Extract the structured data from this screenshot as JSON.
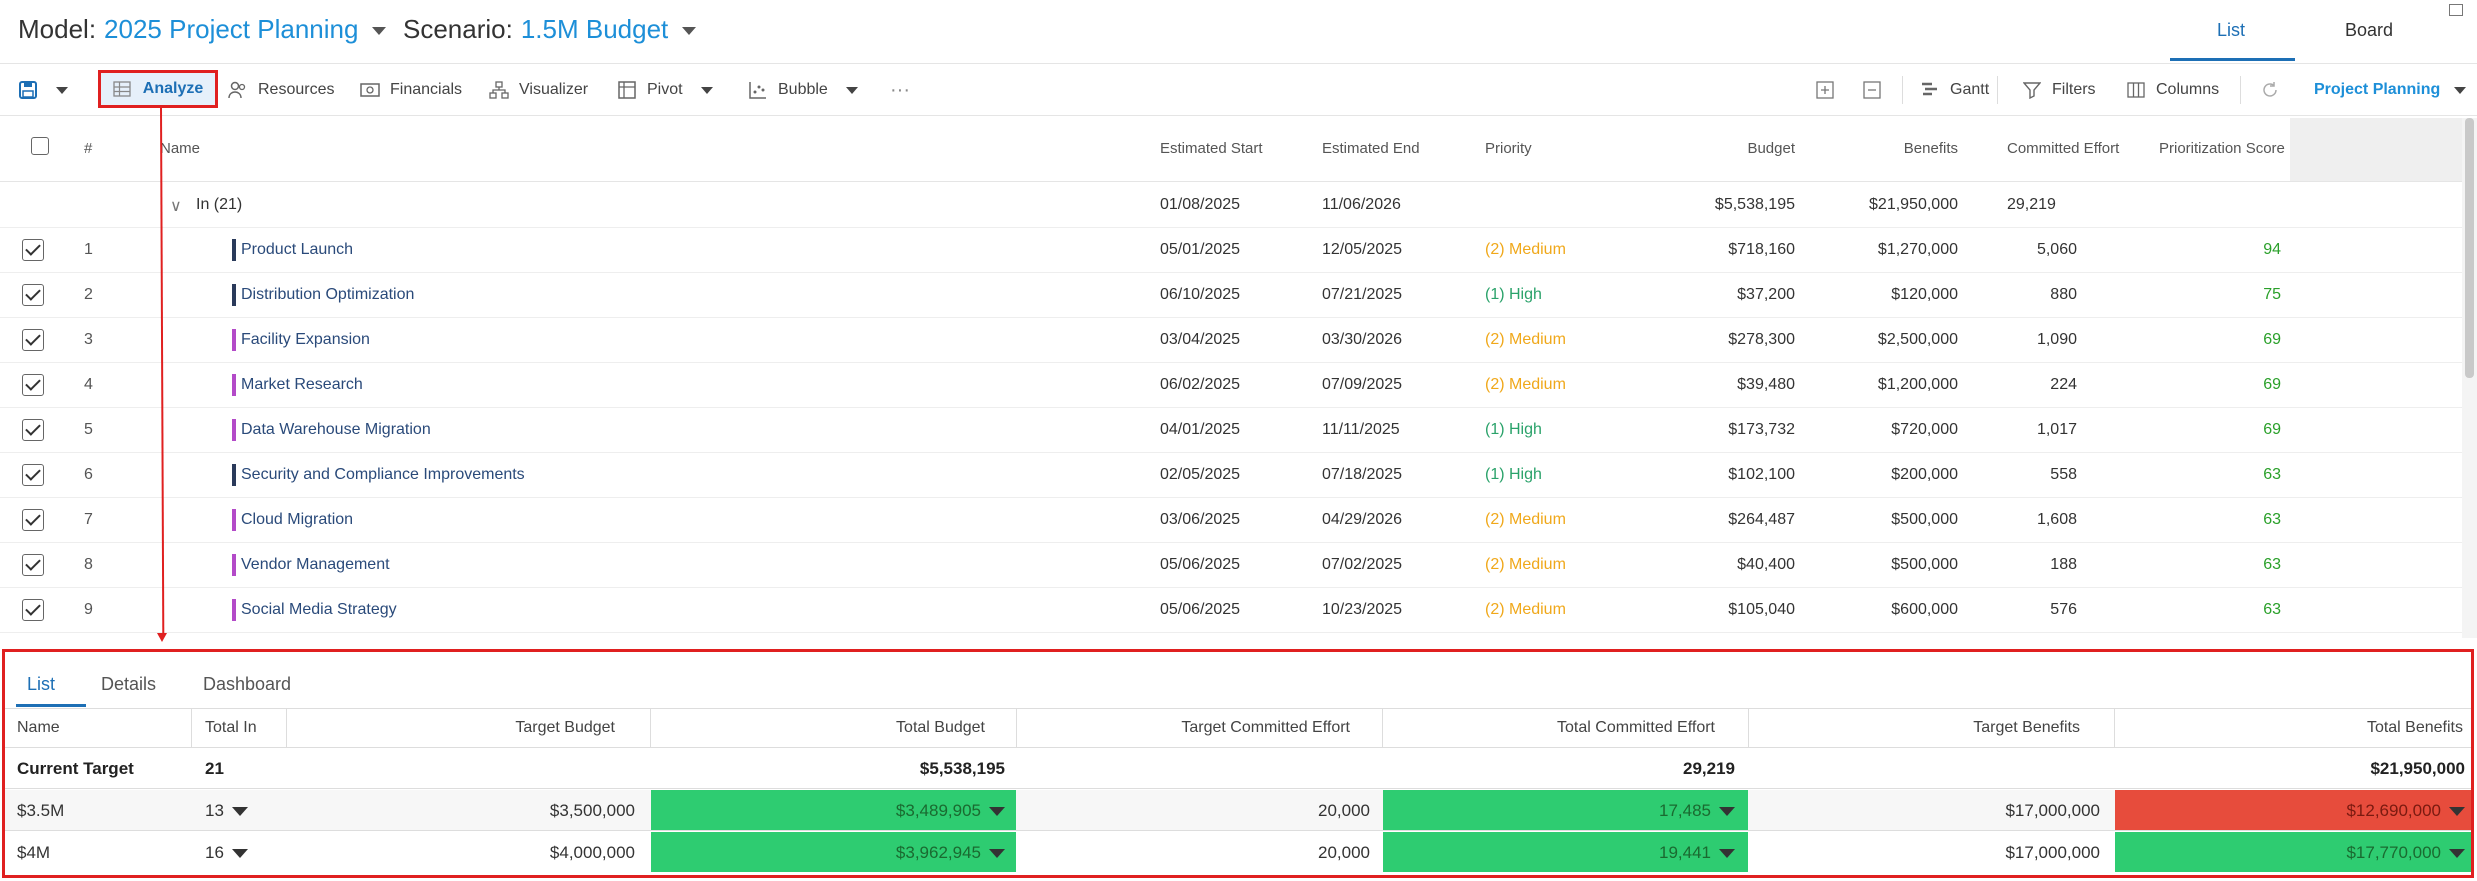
{
  "header": {
    "model_label": "Model:",
    "model_value": "2025 Project Planning",
    "scenario_label": "Scenario:",
    "scenario_value": "1.5M Budget",
    "view_tabs": [
      "List",
      "Board"
    ]
  },
  "toolbar": {
    "analyze": "Analyze",
    "resources": "Resources",
    "financials": "Financials",
    "visualizer": "Visualizer",
    "pivot": "Pivot",
    "bubble": "Bubble",
    "more": "···",
    "gantt": "Gantt",
    "filters": "Filters",
    "columns": "Columns",
    "project_planning": "Project Planning"
  },
  "grid": {
    "columns": [
      "#",
      "Name",
      "Estimated Start",
      "Estimated End",
      "Priority",
      "Budget",
      "Benefits",
      "Committed Effort",
      "Prioritization Score"
    ],
    "group": {
      "label": "In (21)",
      "start": "01/08/2025",
      "end": "11/06/2026",
      "budget": "$5,538,195",
      "benefits": "$21,950,000",
      "effort": "29,219"
    },
    "rows": [
      {
        "num": "1",
        "name": "Product Launch",
        "start": "05/01/2025",
        "end": "12/05/2025",
        "priority": "(2) Medium",
        "budget": "$718,160",
        "benefits": "$1,270,000",
        "effort": "5,060",
        "score": "94"
      },
      {
        "num": "2",
        "name": "Distribution Optimization",
        "start": "06/10/2025",
        "end": "07/21/2025",
        "priority": "(1) High",
        "budget": "$37,200",
        "benefits": "$120,000",
        "effort": "880",
        "score": "75"
      },
      {
        "num": "3",
        "name": "Facility Expansion",
        "start": "03/04/2025",
        "end": "03/30/2026",
        "priority": "(2) Medium",
        "budget": "$278,300",
        "benefits": "$2,500,000",
        "effort": "1,090",
        "score": "69"
      },
      {
        "num": "4",
        "name": "Market Research",
        "start": "06/02/2025",
        "end": "07/09/2025",
        "priority": "(2) Medium",
        "budget": "$39,480",
        "benefits": "$1,200,000",
        "effort": "224",
        "score": "69"
      },
      {
        "num": "5",
        "name": "Data Warehouse Migration",
        "start": "04/01/2025",
        "end": "11/11/2025",
        "priority": "(1) High",
        "budget": "$173,732",
        "benefits": "$720,000",
        "effort": "1,017",
        "score": "69"
      },
      {
        "num": "6",
        "name": "Security and Compliance Improvements",
        "start": "02/05/2025",
        "end": "07/18/2025",
        "priority": "(1) High",
        "budget": "$102,100",
        "benefits": "$200,000",
        "effort": "558",
        "score": "63"
      },
      {
        "num": "7",
        "name": "Cloud Migration",
        "start": "03/06/2025",
        "end": "04/29/2026",
        "priority": "(2) Medium",
        "budget": "$264,487",
        "benefits": "$500,000",
        "effort": "1,608",
        "score": "63"
      },
      {
        "num": "8",
        "name": "Vendor Management",
        "start": "05/06/2025",
        "end": "07/02/2025",
        "priority": "(2) Medium",
        "budget": "$40,400",
        "benefits": "$500,000",
        "effort": "188",
        "score": "63"
      },
      {
        "num": "9",
        "name": "Social Media Strategy",
        "start": "05/06/2025",
        "end": "10/23/2025",
        "priority": "(2) Medium",
        "budget": "$105,040",
        "benefits": "$600,000",
        "effort": "576",
        "score": "63"
      }
    ]
  },
  "panel": {
    "tabs": [
      "List",
      "Details",
      "Dashboard"
    ],
    "columns": [
      "Name",
      "Total In",
      "Target Budget",
      "Total Budget",
      "Target Committed Effort",
      "Total Committed Effort",
      "Target Benefits",
      "Total Benefits"
    ],
    "current": {
      "name": "Current Target",
      "total_in": "21",
      "total_budget": "$5,538,195",
      "total_effort": "29,219",
      "total_benefits": "$21,950,000"
    },
    "rows": [
      {
        "name": "$3.5M",
        "total_in": "13",
        "target_budget": "$3,500,000",
        "total_budget": "$3,489,905",
        "target_effort": "20,000",
        "total_effort": "17,485",
        "target_benefits": "$17,000,000",
        "total_benefits": "$12,690,000"
      },
      {
        "name": "$4M",
        "total_in": "16",
        "target_budget": "$4,000,000",
        "total_budget": "$3,962,945",
        "target_effort": "20,000",
        "total_effort": "19,441",
        "target_benefits": "$17,000,000",
        "total_benefits": "$17,770,000"
      }
    ]
  },
  "colors": {
    "accent": "#1d8fd8",
    "highlight": "#e02020",
    "ok": "#2ecc71",
    "bad": "#e74c3c",
    "medium": "#f0a81a",
    "high": "#2aa26a"
  }
}
